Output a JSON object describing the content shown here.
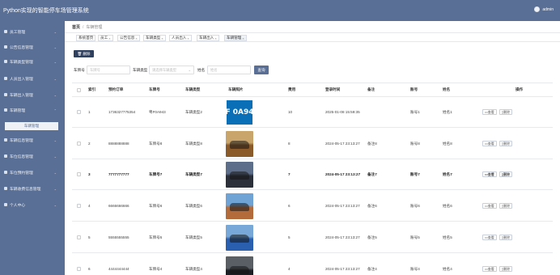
{
  "app": {
    "title": "Python实现的智能停车场管理系统",
    "user": "admin"
  },
  "sidebar": {
    "items": [
      {
        "label": "员工管理",
        "icon": "grid-icon"
      },
      {
        "label": "公告信息管理",
        "icon": "grid-icon"
      },
      {
        "label": "车辆类型管理",
        "icon": "grid-icon"
      },
      {
        "label": "人员出入管理",
        "icon": "grid-icon"
      },
      {
        "label": "车辆出入管理",
        "icon": "grid-icon"
      },
      {
        "label": "车辆管理",
        "icon": "grid-icon"
      },
      {
        "label": "车辆信息管理",
        "icon": "grid-icon"
      },
      {
        "label": "车位信息管理",
        "icon": "grid-icon"
      },
      {
        "label": "车位预约管理",
        "icon": "grid-icon"
      },
      {
        "label": "车辆收费信息管理",
        "icon": "grid-icon"
      },
      {
        "label": "个人中心",
        "icon": "monitor-icon"
      }
    ],
    "sub_item": "车辆管理"
  },
  "breadcrumb": {
    "home": "首页",
    "sep": "/",
    "current": "车辆管理"
  },
  "tabs": [
    {
      "label": "系统首页",
      "closable": false
    },
    {
      "label": "员工",
      "closable": true
    },
    {
      "label": "公告信息",
      "closable": true
    },
    {
      "label": "车辆类型",
      "closable": true
    },
    {
      "label": "人员出入",
      "closable": true
    },
    {
      "label": "车辆出入",
      "closable": true
    },
    {
      "label": "车辆管理",
      "closable": true
    }
  ],
  "toolbar": {
    "delete_label": "删除",
    "delete_icon": "trash-icon"
  },
  "filters": {
    "plate_label": "车牌号",
    "plate_placeholder": "车牌号",
    "type_label": "车辆类型",
    "type_placeholder": "请选择车辆类型",
    "name_label": "姓名",
    "name_placeholder": "姓名",
    "query_label": "查询"
  },
  "table": {
    "headers": [
      "索引",
      "预约订单",
      "车牌号",
      "车辆类型",
      "车辆照片",
      "费用",
      "登录时间",
      "备注",
      "账号",
      "姓名",
      "操作"
    ],
    "view_label": "查看",
    "delete_label": "删除",
    "rows": [
      {
        "index": "1",
        "order": "1736327775354",
        "plate": "粤F0A943",
        "type": "车辆类型2",
        "photo": "plate-photo",
        "fee": "10",
        "time": "2025-01-08 15:59:35",
        "note": "",
        "account": "账号1",
        "name": "姓名1"
      },
      {
        "index": "2",
        "order": "8888888888",
        "plate": "车牌号8",
        "type": "车辆类型8",
        "photo": "car-photo",
        "fee": "8",
        "time": "2024-05-17 23:13:27",
        "note": "备注8",
        "account": "账号8",
        "name": "姓名8"
      },
      {
        "index": "3",
        "order": "7777777777",
        "plate": "车牌号7",
        "type": "车辆类型7",
        "photo": "car-photo",
        "fee": "7",
        "time": "2024-05-17 23:13:27",
        "note": "备注7",
        "account": "账号7",
        "name": "姓名7"
      },
      {
        "index": "4",
        "order": "6666666666",
        "plate": "车牌号6",
        "type": "车辆类型6",
        "photo": "car-photo",
        "fee": "6",
        "time": "2024-05-17 23:13:27",
        "note": "备注6",
        "account": "账号6",
        "name": "姓名6"
      },
      {
        "index": "5",
        "order": "5555555555",
        "plate": "车牌号5",
        "type": "车辆类型5",
        "photo": "car-photo",
        "fee": "5",
        "time": "2024-05-17 23:13:27",
        "note": "备注5",
        "account": "账号5",
        "name": "姓名5"
      },
      {
        "index": "6",
        "order": "4444444444",
        "plate": "车牌号4",
        "type": "车辆类型4",
        "photo": "car-photo",
        "fee": "4",
        "time": "2024-05-17 23:13:27",
        "note": "备注4",
        "account": "账号4",
        "name": "姓名4"
      }
    ]
  },
  "colors": {
    "primary": "#5a6f95",
    "dark_button": "#2f3f5e",
    "border": "#e7e9ee"
  }
}
